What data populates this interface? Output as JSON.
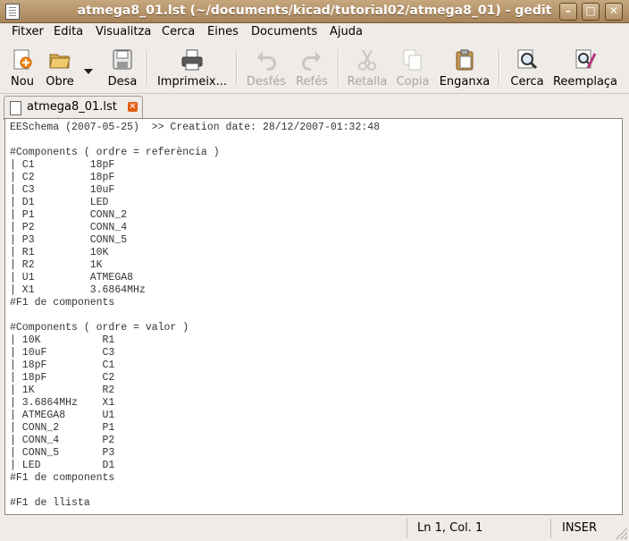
{
  "window": {
    "title": "atmega8_01.lst (~/documents/kicad/tutorial02/atmega8_01) - gedit",
    "minimize": "–",
    "maximize": "□",
    "close": "✕"
  },
  "menu": {
    "items": [
      "Fitxer",
      "Edita",
      "Visualitza",
      "Cerca",
      "Eines",
      "Documents",
      "Ajuda"
    ]
  },
  "toolbar": {
    "new": "Nou",
    "open": "Obre",
    "save": "Desa",
    "print": "Imprimeix...",
    "undo": "Desfés",
    "redo": "Refés",
    "cut": "Retalla",
    "copy": "Copia",
    "paste": "Enganxa",
    "find": "Cerca",
    "replace": "Reemplaça"
  },
  "tab": {
    "label": "atmega8_01.lst",
    "close": "✕"
  },
  "document": {
    "lines": [
      "EESchema (2007-05-25)  >> Creation date: 28/12/2007-01:32:48",
      "",
      "#Components ( ordre = referència )",
      "| C1         18pF",
      "| C2         18pF",
      "| C3         10uF",
      "| D1         LED",
      "| P1         CONN_2",
      "| P2         CONN_4",
      "| P3         CONN_5",
      "| R1         10K",
      "| R2         1K",
      "| U1         ATMEGA8",
      "| X1         3.6864MHz",
      "#F1 de components",
      "",
      "#Components ( ordre = valor )",
      "| 10K          R1",
      "| 10uF         C3",
      "| 18pF         C1",
      "| 18pF         C2",
      "| 1K           R2",
      "| 3.6864MHz    X1",
      "| ATMEGA8      U1",
      "| CONN_2       P1",
      "| CONN_4       P2",
      "| CONN_5       P3",
      "| LED          D1",
      "#F1 de components",
      "",
      "#F1 de llista"
    ]
  },
  "status": {
    "position": "Ln 1, Col. 1",
    "mode": "INSER"
  }
}
